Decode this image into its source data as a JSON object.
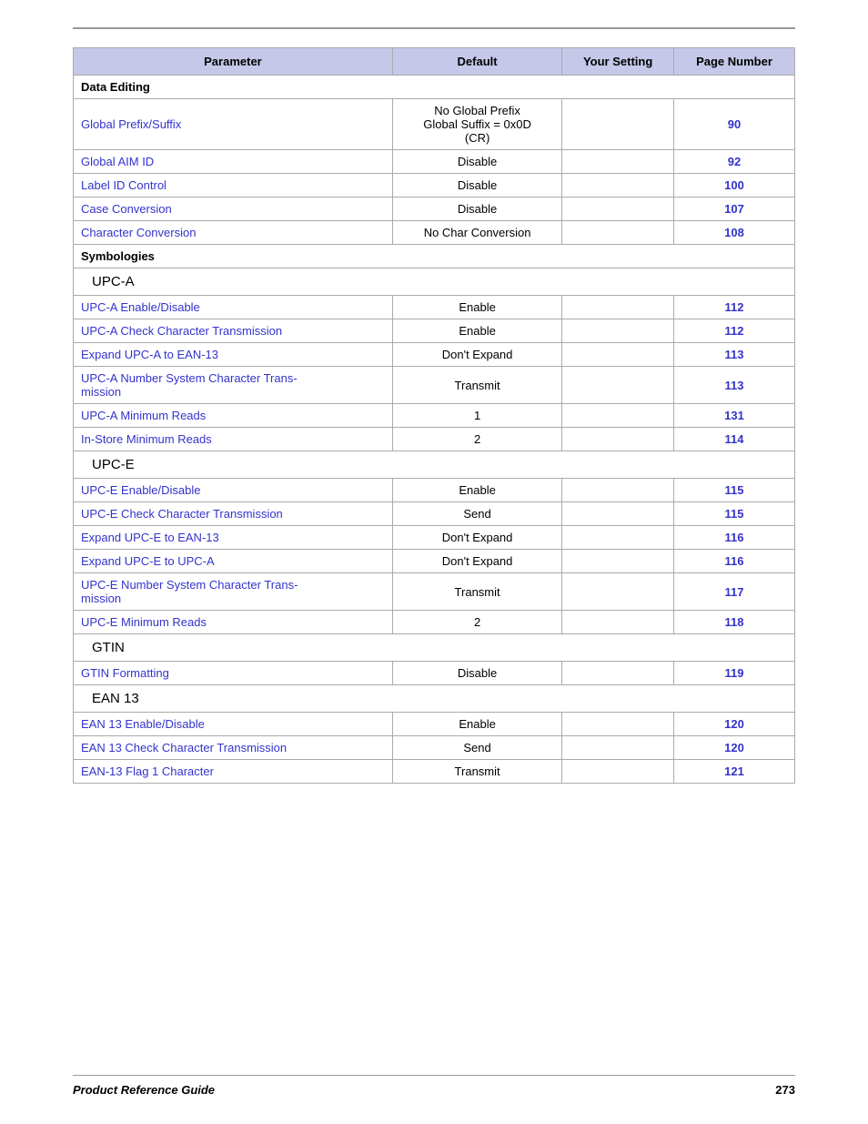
{
  "header": {
    "col1": "Parameter",
    "col2": "Default",
    "col3": "Your Setting",
    "col4": "Page Number"
  },
  "sections": [
    {
      "type": "section",
      "label": "Data Editing"
    },
    {
      "type": "row",
      "param": "Global Prefix/Suffix",
      "default": "No Global Prefix\nGlobal Suffix = 0x0D\n(CR)",
      "page": "90"
    },
    {
      "type": "row",
      "param": "Global AIM ID",
      "default": "Disable",
      "page": "92"
    },
    {
      "type": "row",
      "param": "Label ID Control",
      "default": "Disable",
      "page": "100"
    },
    {
      "type": "row",
      "param": "Case Conversion",
      "default": "Disable",
      "page": "107"
    },
    {
      "type": "row",
      "param": "Character Conversion",
      "default": "No Char Conversion",
      "page": "108"
    },
    {
      "type": "section",
      "label": "Symbologies"
    },
    {
      "type": "subsection",
      "label": "UPC-A"
    },
    {
      "type": "row",
      "param": "UPC-A Enable/Disable",
      "default": "Enable",
      "page": "112"
    },
    {
      "type": "row",
      "param": "UPC-A Check Character Transmission",
      "default": "Enable",
      "page": "112"
    },
    {
      "type": "row",
      "param": "Expand UPC-A to EAN-13",
      "default": "Don't Expand",
      "page": "113"
    },
    {
      "type": "row",
      "param": "UPC-A Number System Character Trans-\nmission",
      "default": "Transmit",
      "page": "113"
    },
    {
      "type": "row",
      "param": "UPC-A Minimum Reads",
      "default": "1",
      "page": "131"
    },
    {
      "type": "row",
      "param": "In-Store Minimum Reads",
      "default": "2",
      "page": "114"
    },
    {
      "type": "subsection",
      "label": "UPC-E"
    },
    {
      "type": "row",
      "param": "UPC-E Enable/Disable",
      "default": "Enable",
      "page": "115"
    },
    {
      "type": "row",
      "param": "UPC-E Check Character Transmission",
      "default": "Send",
      "page": "115"
    },
    {
      "type": "row",
      "param": "Expand UPC-E to EAN-13",
      "default": "Don't Expand",
      "page": "116"
    },
    {
      "type": "row",
      "param": "Expand UPC-E to UPC-A",
      "default": "Don't Expand",
      "page": "116"
    },
    {
      "type": "row",
      "param": "UPC-E Number System Character Trans-\nmission",
      "default": "Transmit",
      "page": "117"
    },
    {
      "type": "row",
      "param": "UPC-E Minimum Reads",
      "default": "2",
      "page": "118"
    },
    {
      "type": "subsection",
      "label": "GTIN"
    },
    {
      "type": "row",
      "param": "GTIN Formatting",
      "default": "Disable",
      "page": "119"
    },
    {
      "type": "subsection",
      "label": "EAN 13"
    },
    {
      "type": "row",
      "param": "EAN 13 Enable/Disable",
      "default": "Enable",
      "page": "120"
    },
    {
      "type": "row",
      "param": "EAN 13 Check Character Transmission",
      "default": "Send",
      "page": "120"
    },
    {
      "type": "row",
      "param": "EAN-13 Flag 1 Character",
      "default": "Transmit",
      "page": "121"
    }
  ],
  "footer": {
    "left": "Product Reference Guide",
    "right": "273"
  }
}
